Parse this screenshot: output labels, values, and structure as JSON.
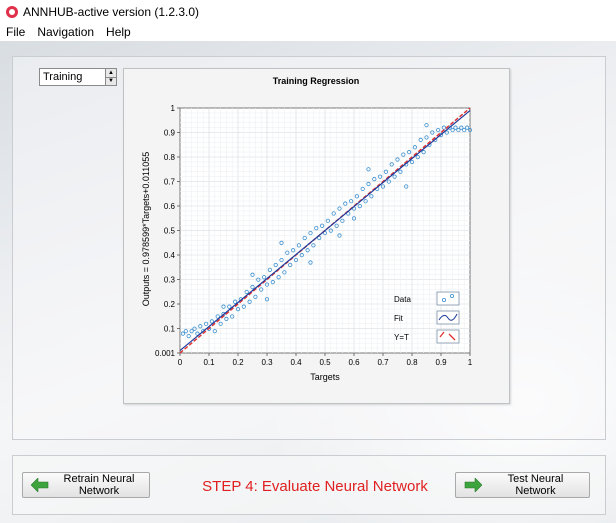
{
  "window": {
    "title": "ANNHUB-active version (1.2.3.0)"
  },
  "menu": [
    "File",
    "Navigation",
    "Help"
  ],
  "dataset_select": {
    "value": "Training"
  },
  "chart_data": {
    "type": "scatter",
    "title": "Training Regression",
    "xlabel": "Targets",
    "ylabel": "Outputs = 0.978599*Targets+0.011055",
    "xlim": [
      0,
      1
    ],
    "ylim": [
      0.001,
      1
    ],
    "x_ticks": [
      "0",
      "0.1",
      "0.2",
      "0.3",
      "0.4",
      "0.5",
      "0.6",
      "0.7",
      "0.8",
      "0.9",
      "1"
    ],
    "y_ticks": [
      "0.001",
      "0.1",
      "0.2",
      "0.3",
      "0.4",
      "0.5",
      "0.6",
      "0.7",
      "0.8",
      "0.9",
      "1"
    ],
    "grid": true,
    "legend_position": "bottom-right",
    "legend": [
      "Data",
      "Fit",
      "Y=T"
    ],
    "fit": {
      "slope": 0.978599,
      "intercept": 0.011055
    },
    "colors": {
      "data": "#3a8fd0",
      "fit": "#1f3b9a",
      "ideal": "#e03030"
    },
    "points": [
      [
        0.01,
        0.08
      ],
      [
        0.02,
        0.09
      ],
      [
        0.03,
        0.07
      ],
      [
        0.04,
        0.09
      ],
      [
        0.05,
        0.1
      ],
      [
        0.06,
        0.08
      ],
      [
        0.07,
        0.11
      ],
      [
        0.08,
        0.09
      ],
      [
        0.09,
        0.12
      ],
      [
        0.1,
        0.1
      ],
      [
        0.11,
        0.13
      ],
      [
        0.12,
        0.09
      ],
      [
        0.13,
        0.15
      ],
      [
        0.14,
        0.12
      ],
      [
        0.15,
        0.16
      ],
      [
        0.16,
        0.14
      ],
      [
        0.17,
        0.19
      ],
      [
        0.18,
        0.15
      ],
      [
        0.19,
        0.21
      ],
      [
        0.2,
        0.18
      ],
      [
        0.21,
        0.22
      ],
      [
        0.22,
        0.19
      ],
      [
        0.23,
        0.25
      ],
      [
        0.24,
        0.21
      ],
      [
        0.25,
        0.27
      ],
      [
        0.26,
        0.23
      ],
      [
        0.27,
        0.3
      ],
      [
        0.28,
        0.26
      ],
      [
        0.29,
        0.31
      ],
      [
        0.3,
        0.28
      ],
      [
        0.31,
        0.34
      ],
      [
        0.32,
        0.29
      ],
      [
        0.33,
        0.36
      ],
      [
        0.34,
        0.31
      ],
      [
        0.35,
        0.38
      ],
      [
        0.36,
        0.33
      ],
      [
        0.37,
        0.41
      ],
      [
        0.38,
        0.36
      ],
      [
        0.39,
        0.42
      ],
      [
        0.4,
        0.38
      ],
      [
        0.41,
        0.44
      ],
      [
        0.42,
        0.4
      ],
      [
        0.43,
        0.47
      ],
      [
        0.44,
        0.42
      ],
      [
        0.45,
        0.49
      ],
      [
        0.46,
        0.44
      ],
      [
        0.47,
        0.51
      ],
      [
        0.48,
        0.47
      ],
      [
        0.49,
        0.52
      ],
      [
        0.5,
        0.49
      ],
      [
        0.51,
        0.54
      ],
      [
        0.52,
        0.5
      ],
      [
        0.53,
        0.57
      ],
      [
        0.54,
        0.52
      ],
      [
        0.55,
        0.59
      ],
      [
        0.56,
        0.54
      ],
      [
        0.57,
        0.61
      ],
      [
        0.58,
        0.57
      ],
      [
        0.59,
        0.62
      ],
      [
        0.6,
        0.59
      ],
      [
        0.61,
        0.64
      ],
      [
        0.62,
        0.6
      ],
      [
        0.63,
        0.67
      ],
      [
        0.64,
        0.62
      ],
      [
        0.65,
        0.69
      ],
      [
        0.66,
        0.64
      ],
      [
        0.67,
        0.71
      ],
      [
        0.68,
        0.67
      ],
      [
        0.69,
        0.72
      ],
      [
        0.7,
        0.68
      ],
      [
        0.71,
        0.74
      ],
      [
        0.72,
        0.7
      ],
      [
        0.73,
        0.77
      ],
      [
        0.74,
        0.72
      ],
      [
        0.75,
        0.79
      ],
      [
        0.76,
        0.74
      ],
      [
        0.77,
        0.81
      ],
      [
        0.78,
        0.77
      ],
      [
        0.79,
        0.82
      ],
      [
        0.8,
        0.78
      ],
      [
        0.81,
        0.84
      ],
      [
        0.82,
        0.8
      ],
      [
        0.83,
        0.87
      ],
      [
        0.84,
        0.82
      ],
      [
        0.85,
        0.88
      ],
      [
        0.86,
        0.85
      ],
      [
        0.87,
        0.9
      ],
      [
        0.88,
        0.87
      ],
      [
        0.89,
        0.91
      ],
      [
        0.9,
        0.89
      ],
      [
        0.91,
        0.92
      ],
      [
        0.92,
        0.9
      ],
      [
        0.93,
        0.92
      ],
      [
        0.94,
        0.91
      ],
      [
        0.95,
        0.92
      ],
      [
        0.96,
        0.91
      ],
      [
        0.97,
        0.92
      ],
      [
        0.98,
        0.91
      ],
      [
        0.99,
        0.92
      ],
      [
        1.0,
        0.91
      ],
      [
        0.15,
        0.19
      ],
      [
        0.3,
        0.22
      ],
      [
        0.45,
        0.37
      ],
      [
        0.55,
        0.48
      ],
      [
        0.65,
        0.75
      ],
      [
        0.78,
        0.68
      ],
      [
        0.85,
        0.93
      ],
      [
        0.6,
        0.55
      ],
      [
        0.35,
        0.45
      ],
      [
        0.25,
        0.32
      ]
    ]
  },
  "buttons": {
    "retrain": "Retrain Neural Network",
    "test": "Test Neural Network"
  },
  "status": {
    "step": "STEP 4: Evaluate Neural Network"
  }
}
